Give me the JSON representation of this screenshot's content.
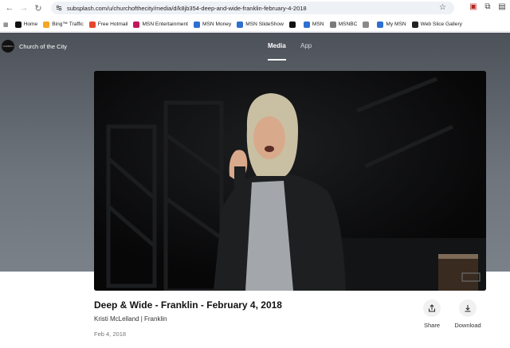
{
  "browser": {
    "url": "subsplash.com/u/churchofthecity/media/d/k8jb354-deep-and-wide-franklin-february-4-2018",
    "bookmarks": [
      {
        "label": "Home",
        "icon": "x-icon",
        "color": "#111111"
      },
      {
        "label": "Bing™ Traffic",
        "icon": "bing-icon",
        "color": "#f5a623"
      },
      {
        "label": "Free Hotmail",
        "icon": "windows-icon",
        "color": "#e8452c"
      },
      {
        "label": "MSN Entertainment",
        "icon": "msn-icon",
        "color": "#c2185b"
      },
      {
        "label": "MSN Money",
        "icon": "msn-butterfly-icon",
        "color": "#2f6fd1"
      },
      {
        "label": "MSN SlideShow",
        "icon": "msn-butterfly-icon",
        "color": "#2f6fd1"
      },
      {
        "label": "",
        "icon": "x-icon",
        "color": "#111111"
      },
      {
        "label": "MSN",
        "icon": "msn-butterfly-icon",
        "color": "#2f6fd1"
      },
      {
        "label": "MSNBC",
        "icon": "msnbc-icon",
        "color": "#7a7a7a"
      },
      {
        "label": "",
        "icon": "page-icon",
        "color": "#8a8a8a"
      },
      {
        "label": "My MSN",
        "icon": "msn-butterfly-icon",
        "color": "#2f6fd1"
      },
      {
        "label": "Web Slice Gallery",
        "icon": "slice-icon",
        "color": "#222222"
      }
    ]
  },
  "site": {
    "name": "Church of the City",
    "tabs": [
      {
        "label": "Media",
        "active": true
      },
      {
        "label": "App",
        "active": false
      }
    ]
  },
  "media": {
    "title": "Deep & Wide - Franklin - February 4, 2018",
    "speaker_line": "Kristi McLelland | Franklin",
    "date": "Feb 4, 2018",
    "actions": {
      "share_label": "Share",
      "download_label": "Download"
    }
  },
  "colors": {
    "hero": "#5e646b",
    "video_bg": "#0c0c0d"
  }
}
